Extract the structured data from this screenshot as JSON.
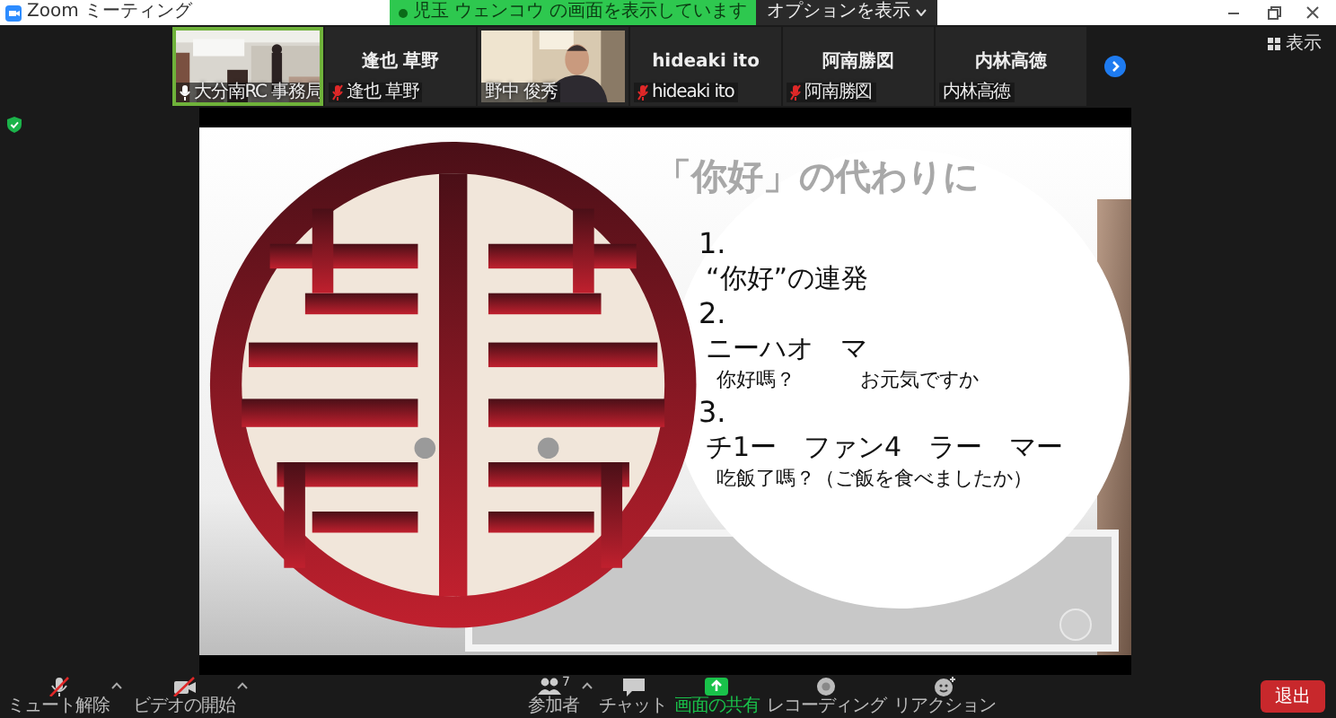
{
  "window": {
    "title": "Zoom ミーティング"
  },
  "share_banner": {
    "text": "児玉 ウェンコウ の画面を表示しています"
  },
  "options_button": {
    "label": "オプションを表示"
  },
  "participant_tiles": [
    {
      "kind": "video",
      "label": "大分南RC 事務局",
      "muted": false,
      "speaking": true
    },
    {
      "kind": "name",
      "display_name": "逢也 草野",
      "label": "逢也 草野",
      "muted": true,
      "speaking": false
    },
    {
      "kind": "video",
      "label": "野中 俊秀",
      "muted": false,
      "speaking": false
    },
    {
      "kind": "name",
      "display_name": "hideaki ito",
      "label": "hideaki ito",
      "muted": true,
      "speaking": false
    },
    {
      "kind": "name",
      "display_name": "阿南勝図",
      "label": "阿南勝図",
      "muted": true,
      "speaking": false
    },
    {
      "kind": "name",
      "display_name": "内林高徳",
      "label": "内林高徳",
      "muted": false,
      "speaking": false
    }
  ],
  "view_button": {
    "label": "表示"
  },
  "slide": {
    "title": "「你好」の代わりに",
    "items": [
      {
        "number": "1.",
        "lines": [
          {
            "kind": "main",
            "segments": [
              "“你好”の連発"
            ]
          }
        ]
      },
      {
        "number": "2.",
        "lines": [
          {
            "kind": "main",
            "segments": [
              "ニーハオ　マ"
            ]
          },
          {
            "kind": "note",
            "segments": [
              "你好嗎？",
              "お元気ですか"
            ]
          }
        ]
      },
      {
        "number": "3.",
        "lines": [
          {
            "kind": "main",
            "segments": [
              "チ1ー　ファン4　ラー　マー"
            ]
          },
          {
            "kind": "note",
            "segments": [
              "吃飯了嗎？（ご飯を食べましたか）"
            ]
          }
        ]
      }
    ]
  },
  "toolbar": [
    {
      "kind": "mute",
      "label": "ミュート解除",
      "caret": true,
      "active": false
    },
    {
      "kind": "video",
      "label": "ビデオの開始",
      "caret": true,
      "active": false
    },
    {
      "kind": "participants",
      "label": "参加者",
      "count": "7",
      "caret": true,
      "active": false
    },
    {
      "kind": "chat",
      "label": "チャット",
      "active": false
    },
    {
      "kind": "share",
      "label": "画面の共有",
      "active": true
    },
    {
      "kind": "record",
      "label": "レコーディング",
      "active": false
    },
    {
      "kind": "reactions",
      "label": "リアクション",
      "active": false
    }
  ],
  "leave_button": {
    "label": "退出"
  }
}
